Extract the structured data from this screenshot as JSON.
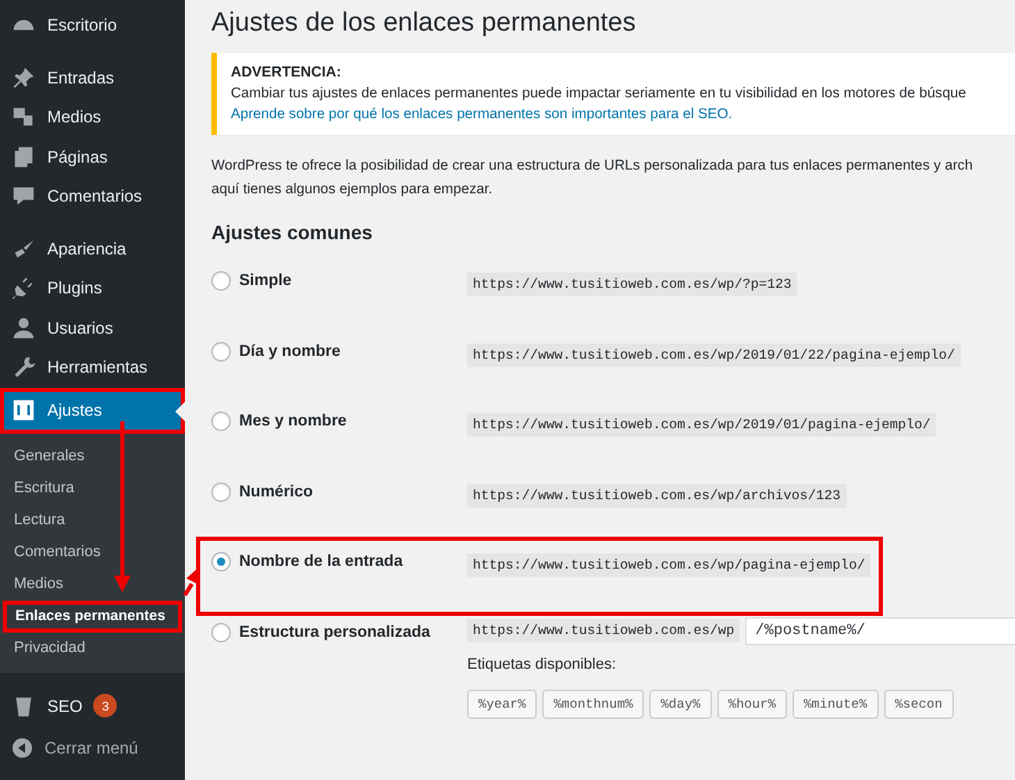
{
  "sidebar": {
    "groups": [
      {
        "items": [
          {
            "label": "Escritorio",
            "selected": false,
            "highlighted": false
          }
        ]
      },
      {
        "items": [
          {
            "label": "Entradas",
            "selected": false,
            "highlighted": false
          },
          {
            "label": "Medios",
            "selected": false,
            "highlighted": false
          },
          {
            "label": "Páginas",
            "selected": false,
            "highlighted": false
          },
          {
            "label": "Comentarios",
            "selected": false,
            "highlighted": false
          }
        ]
      },
      {
        "items": [
          {
            "label": "Apariencia",
            "selected": false,
            "highlighted": false
          },
          {
            "label": "Plugins",
            "selected": false,
            "highlighted": false
          },
          {
            "label": "Usuarios",
            "selected": false,
            "highlighted": false
          },
          {
            "label": "Herramientas",
            "selected": false,
            "highlighted": false
          },
          {
            "label": "Ajustes",
            "selected": true,
            "highlighted": true,
            "submenu": [
              {
                "label": "Generales",
                "selected": false,
                "highlighted": false
              },
              {
                "label": "Escritura",
                "selected": false,
                "highlighted": false
              },
              {
                "label": "Lectura",
                "selected": false,
                "highlighted": false
              },
              {
                "label": "Comentarios",
                "selected": false,
                "highlighted": false
              },
              {
                "label": "Medios",
                "selected": false,
                "highlighted": false
              },
              {
                "label": "Enlaces permanentes",
                "selected": true,
                "highlighted": true
              },
              {
                "label": "Privacidad",
                "selected": false,
                "highlighted": false
              }
            ]
          }
        ]
      },
      {
        "items": [
          {
            "label": "SEO",
            "badge": "3",
            "selected": false,
            "highlighted": false
          }
        ]
      }
    ],
    "collapse": "Cerrar menú"
  },
  "page": {
    "title": "Ajustes de los enlaces permanentes",
    "notice": {
      "heading": "ADVERTENCIA:",
      "text": "Cambiar tus ajustes de enlaces permanentes puede impactar seriamente en tu visibilidad en los motores de búsque",
      "link": "Aprende sobre por qué los enlaces permanentes son importantes para el SEO."
    },
    "intro": [
      "WordPress te ofrece la posibilidad de crear una estructura de URLs personalizada para tus enlaces permanentes y arch",
      "aquí tienes algunos ejemplos para empezar."
    ],
    "section": "Ajustes comunes",
    "options": [
      {
        "kind": "example",
        "label": "Simple",
        "url": "https://www.tusitioweb.com.es/wp/?p=123",
        "selected": false,
        "highlighted": false
      },
      {
        "kind": "example",
        "label": "Día y nombre",
        "url": "https://www.tusitioweb.com.es/wp/2019/01/22/pagina-ejemplo/",
        "selected": false,
        "highlighted": false
      },
      {
        "kind": "example",
        "label": "Mes y nombre",
        "url": "https://www.tusitioweb.com.es/wp/2019/01/pagina-ejemplo/",
        "selected": false,
        "highlighted": false
      },
      {
        "kind": "example",
        "label": "Numérico",
        "url": "https://www.tusitioweb.com.es/wp/archivos/123",
        "selected": false,
        "highlighted": false
      },
      {
        "kind": "example",
        "label": "Nombre de la entrada",
        "url": "https://www.tusitioweb.com.es/wp/pagina-ejemplo/",
        "selected": true,
        "highlighted": true
      },
      {
        "kind": "custom",
        "label": "Estructura personalizada",
        "url": "https://www.tusitioweb.com.es/wp",
        "value": "/%postname%/",
        "tags_label": "Etiquetas disponibles:",
        "tags": [
          "%year%",
          "%monthnum%",
          "%day%",
          "%hour%",
          "%minute%",
          "%secon"
        ],
        "selected": false,
        "highlighted": false
      }
    ]
  }
}
